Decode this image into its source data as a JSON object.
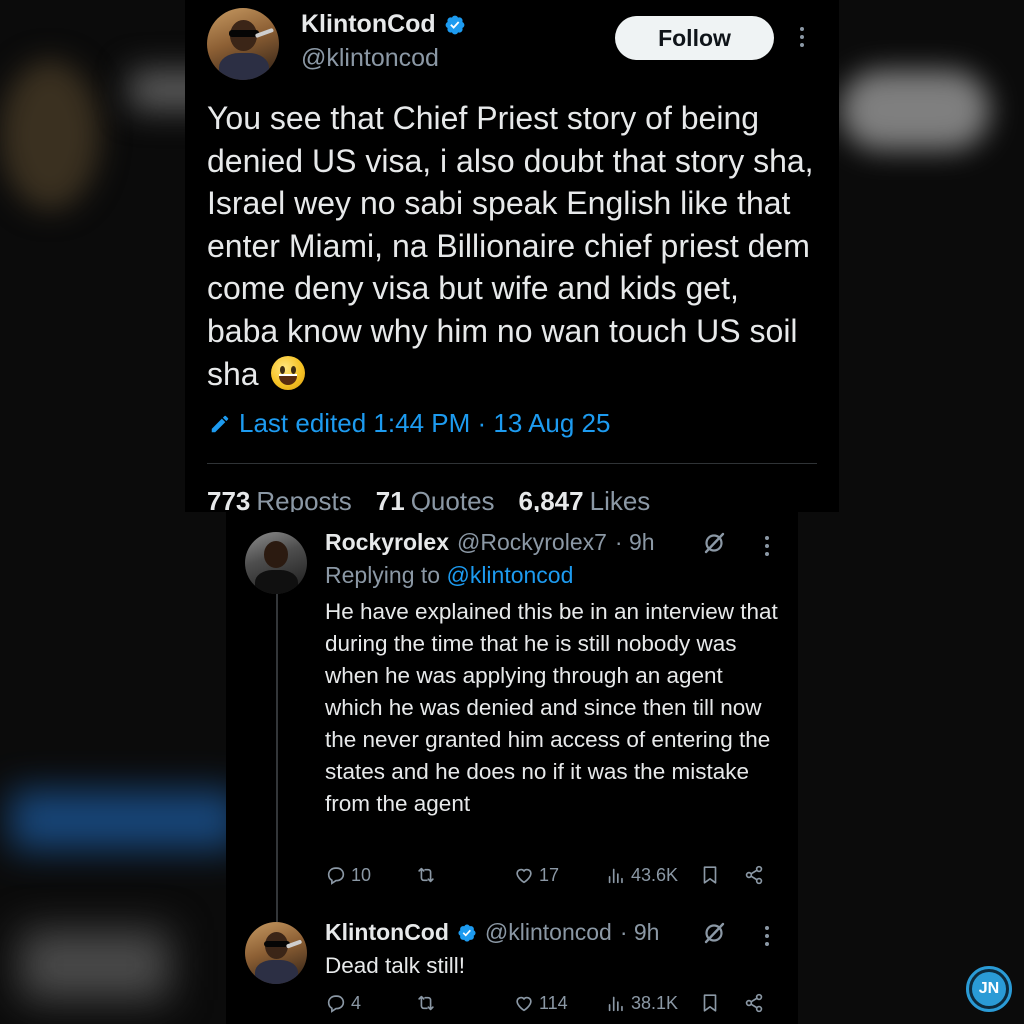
{
  "main_tweet": {
    "author_name": "KlintonCod",
    "author_handle": "@klintoncod",
    "follow_label": "Follow",
    "body": "You see that Chief Priest story of being denied US visa, i also doubt that story sha, Israel wey no sabi speak English like that enter Miami, na Billionaire chief priest dem come deny visa but wife and kids get, baba know why him no wan touch US soil sha",
    "emoji": "grinning-face",
    "edited_label": "Last edited 1:44 PM · 13 Aug 25",
    "stats": {
      "reposts_count": "773",
      "reposts_label": "Reposts",
      "quotes_count": "71",
      "quotes_label": "Quotes",
      "likes_count": "6,847",
      "likes_label": "Likes"
    }
  },
  "replies": [
    {
      "author_name": "Rockyrolex",
      "author_handle": "@Rockyrolex7",
      "time": "· 9h",
      "replying_prefix": "Replying to ",
      "replying_handle": "@klintoncod",
      "body": "He have explained this be in an interview that during the time that he is still nobody was when he was applying through an agent which he was denied and since then till now the never granted him access of entering the states and he does no if it was the mistake from the agent",
      "replies": "10",
      "reposts": "",
      "likes": "17",
      "views": "43.6K"
    },
    {
      "author_name": "KlintonCod",
      "author_handle": "@klintoncod",
      "time": "· 9h",
      "body": "Dead talk still!",
      "replies": "4",
      "reposts": "",
      "likes": "114",
      "views": "38.1K"
    }
  ],
  "watermark": {
    "text": "JN"
  },
  "colors": {
    "accent": "#1d9bf0",
    "muted": "#8b98a5",
    "text": "#e7e9ea",
    "background": "#000000"
  }
}
